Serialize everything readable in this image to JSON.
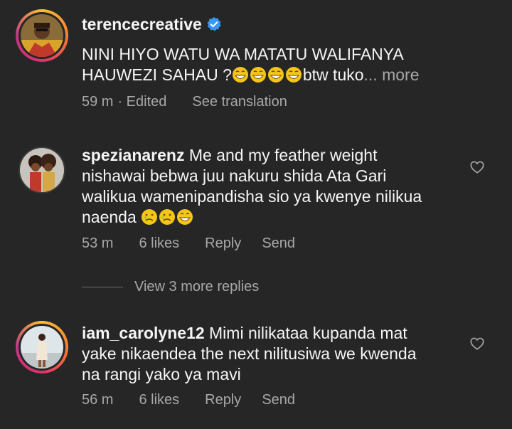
{
  "comments": [
    {
      "username": "terencecreative",
      "verified": true,
      "text_line1": "NINI HIYO WATU WA MATATU WALIFANYA",
      "text_line2": "HAUWEZI SAHAU ?",
      "text_tail": "btw tuko",
      "more_label": "... more",
      "time": "59 m",
      "edited": "· Edited",
      "see_translation": "See translation"
    },
    {
      "username": "spezianarenz",
      "text_line1": "Me and my feather weight",
      "text_line2": "nishawai bebwa juu nakuru shida Ata Gari",
      "text_line3": "walikua wamenipandisha sio  ya kwenye nilikua",
      "text_line4": "naenda",
      "time": "53 m",
      "likes": "6 likes",
      "reply": "Reply",
      "send": "Send"
    },
    {
      "username": "iam_carolyne12",
      "text_line1": "Mimi nilikataa kupanda mat",
      "text_line2": "yake nikaendea the next nilitusiwa we kwenda",
      "text_line3": "na rangi yako ya mavi",
      "time": "56 m",
      "likes": "6 likes",
      "reply": "Reply",
      "send": "Send"
    }
  ],
  "view_replies_label": "View 3 more replies",
  "colors": {
    "background": "#262626",
    "primary_text": "#f5f5f5",
    "secondary_text": "#a8a8a8",
    "verified_blue": "#3897f0"
  }
}
